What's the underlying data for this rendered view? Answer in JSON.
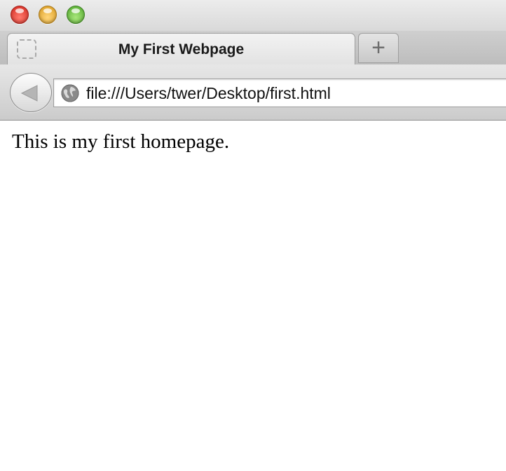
{
  "window": {
    "traffic_lights": [
      "close",
      "minimize",
      "zoom"
    ],
    "colors": {
      "close": "#e0443a",
      "minimize": "#f5b83a",
      "zoom": "#6cc644"
    }
  },
  "tabs": [
    {
      "title": "My First Webpage",
      "active": true,
      "icon": "blank-favicon-icon"
    }
  ],
  "toolbar": {
    "back_icon": "back-arrow-icon",
    "address": {
      "icon": "globe-icon",
      "url": "file:///Users/twer/Desktop/first.html"
    },
    "new_tab_label": "+"
  },
  "page": {
    "text": "This is my first homepage."
  }
}
